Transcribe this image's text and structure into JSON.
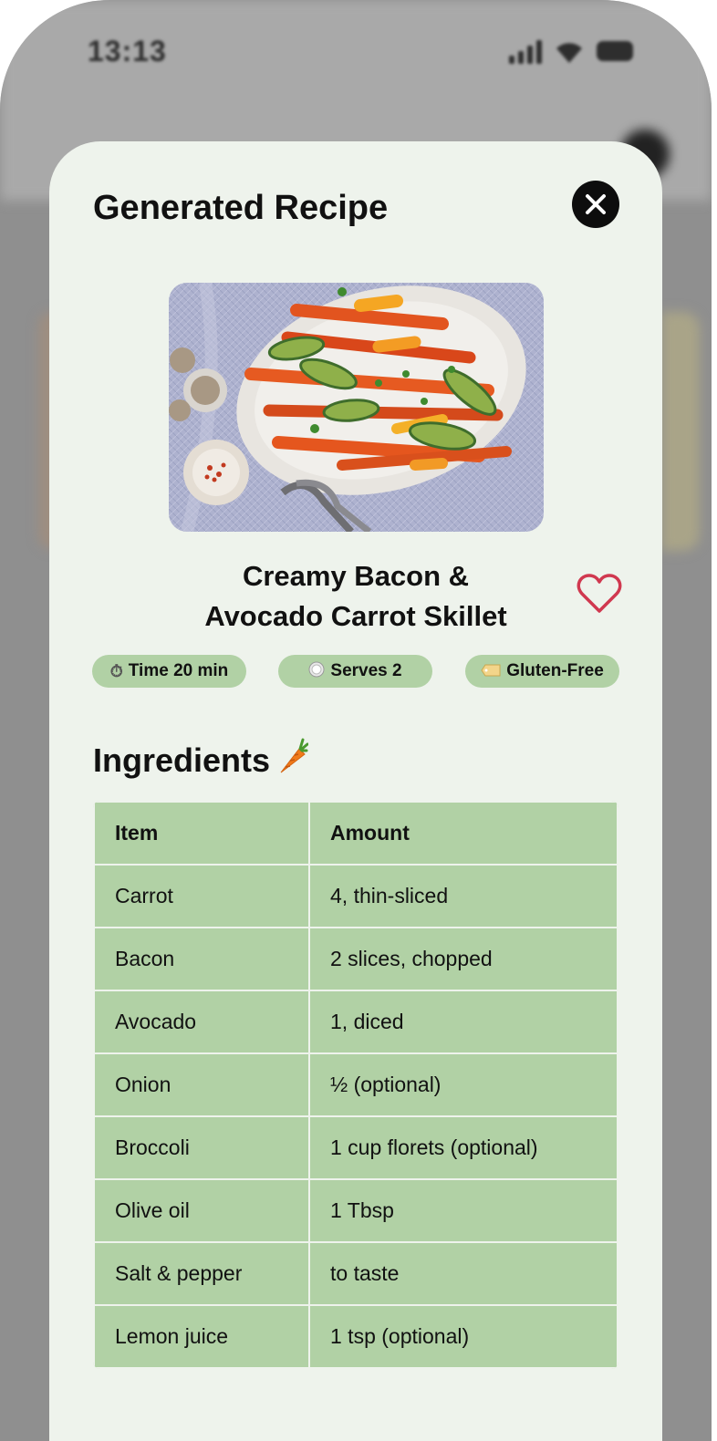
{
  "status_bar": {
    "time": "13:13"
  },
  "modal": {
    "title": "Generated Recipe",
    "close_icon": "close-icon"
  },
  "recipe": {
    "name_line1": "Creamy Bacon &",
    "name_line2": "Avocado Carrot Skillet",
    "favorite_icon": "heart-outline-icon",
    "favorite_color": "#d0384f",
    "tags": [
      {
        "icon": "stopwatch-icon",
        "label": "Time 20 min"
      },
      {
        "icon": "plate-icon",
        "label": "Serves 2"
      },
      {
        "icon": "label-tag-icon",
        "label": "Gluten-Free"
      }
    ]
  },
  "ingredients": {
    "title": "Ingredients",
    "title_icon": "carrot-icon",
    "headers": [
      "Item",
      "Amount"
    ],
    "rows": [
      [
        "Carrot",
        "4, thin-sliced"
      ],
      [
        "Bacon",
        "2 slices, chopped"
      ],
      [
        "Avocado",
        "1, diced"
      ],
      [
        "Onion",
        "½ (optional)"
      ],
      [
        "Broccoli",
        "1 cup florets (optional)"
      ],
      [
        "Olive oil",
        "1 Tbsp"
      ],
      [
        "Salt & pepper",
        "to taste"
      ],
      [
        "Lemon juice",
        "1 tsp (optional)"
      ]
    ]
  },
  "colors": {
    "modal_bg": "#eef3ec",
    "table_bg": "#b1d1a5",
    "tag_bg": "#b1d1a5"
  }
}
